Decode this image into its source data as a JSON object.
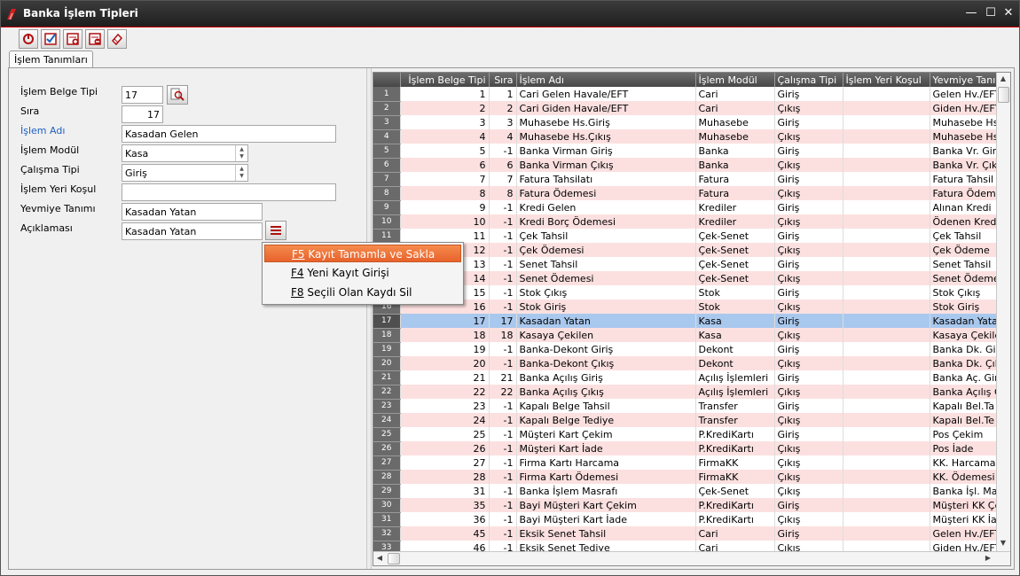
{
  "window": {
    "title": "Banka İşlem Tipleri",
    "minimize": "—",
    "maximize": "☐",
    "close": "✕"
  },
  "toolbar": {
    "buttons": [
      "power-icon",
      "check-list-icon",
      "add-record-icon",
      "delete-record-icon",
      "eraser-icon"
    ]
  },
  "tab": {
    "label": "İşlem Tanımları"
  },
  "form": {
    "islem_belge_tipi": {
      "label": "İşlem Belge Tipi",
      "value": "17"
    },
    "sira": {
      "label": "Sıra",
      "value": "17"
    },
    "islem_adi": {
      "label": "İşlem Adı",
      "value": "Kasadan Gelen"
    },
    "islem_modul": {
      "label": "İşlem Modül",
      "value": "Kasa"
    },
    "calisma_tipi": {
      "label": "Çalışma Tipi",
      "value": "Giriş"
    },
    "islem_yeri_kosul": {
      "label": "İşlem Yeri Koşul",
      "value": ""
    },
    "yevmiye_tanimi": {
      "label": "Yevmiye Tanımı",
      "value": "Kasadan Yatan"
    },
    "aciklamasi": {
      "label": "Açıklaması",
      "value": "Kasadan Yatan"
    }
  },
  "menu": {
    "items": [
      {
        "key": "F5",
        "label": "Kayıt Tamamla ve Sakla"
      },
      {
        "key": "F4",
        "label": "Yeni Kayıt Girişi"
      },
      {
        "key": "F8",
        "label": "Seçili Olan Kaydı Sil"
      }
    ]
  },
  "grid": {
    "columns": [
      "İşlem Belge Tipi",
      "Sıra",
      "İşlem Adı",
      "İşlem Modül",
      "Çalışma Tipi",
      "İşlem Yeri Koşul",
      "Yevmiye Tanım"
    ],
    "selected_row": 17,
    "rows": [
      [
        "1",
        "1",
        "1",
        "Cari Gelen Havale/EFT",
        "Cari",
        "Giriş",
        "",
        "Gelen Hv./EFT"
      ],
      [
        "2",
        "2",
        "2",
        "Cari Giden Havale/EFT",
        "Cari",
        "Çıkış",
        "",
        "Giden Hv./EFT"
      ],
      [
        "3",
        "3",
        "3",
        "Muhasebe Hs.Giriş",
        "Muhasebe",
        "Giriş",
        "",
        "Muhasebe Hs"
      ],
      [
        "4",
        "4",
        "4",
        "Muhasebe Hs.Çıkış",
        "Muhasebe",
        "Çıkış",
        "",
        "Muhasebe Hs"
      ],
      [
        "5",
        "5",
        "-1",
        "Banka Virman Giriş",
        "Banka",
        "Giriş",
        "",
        "Banka Vr. Giri"
      ],
      [
        "6",
        "6",
        "6",
        "Banka Virman Çıkış",
        "Banka",
        "Çıkış",
        "",
        "Banka Vr. Çıkı"
      ],
      [
        "7",
        "7",
        "7",
        "Fatura Tahsilatı",
        "Fatura",
        "Giriş",
        "",
        "Fatura Tahsil"
      ],
      [
        "8",
        "8",
        "8",
        "Fatura Ödemesi",
        "Fatura",
        "Çıkış",
        "",
        "Fatura Ödeme"
      ],
      [
        "9",
        "9",
        "-1",
        "Kredi Gelen",
        "Krediler",
        "Giriş",
        "",
        "Alınan Kredi"
      ],
      [
        "10",
        "10",
        "-1",
        "Kredi Borç Ödemesi",
        "Krediler",
        "Çıkış",
        "",
        "Ödenen Kredi"
      ],
      [
        "11",
        "11",
        "-1",
        "Çek Tahsil",
        "Çek-Senet",
        "Giriş",
        "",
        "Çek Tahsil"
      ],
      [
        "12",
        "12",
        "-1",
        "Çek Ödemesi",
        "Çek-Senet",
        "Çıkış",
        "",
        "Çek Ödeme"
      ],
      [
        "13",
        "13",
        "-1",
        "Senet Tahsil",
        "Çek-Senet",
        "Giriş",
        "",
        "Senet Tahsil"
      ],
      [
        "14",
        "14",
        "-1",
        "Senet Ödemesi",
        "Çek-Senet",
        "Çıkış",
        "",
        "Senet Ödeme"
      ],
      [
        "15",
        "15",
        "-1",
        "Stok Çıkış",
        "Stok",
        "Giriş",
        "",
        "Stok Çıkış"
      ],
      [
        "16",
        "16",
        "-1",
        "Stok Giriş",
        "Stok",
        "Çıkış",
        "",
        "Stok Giriş"
      ],
      [
        "17",
        "17",
        "17",
        "Kasadan Yatan",
        "Kasa",
        "Giriş",
        "",
        "Kasadan Yatan"
      ],
      [
        "18",
        "18",
        "18",
        "Kasaya Çekilen",
        "Kasa",
        "Çıkış",
        "",
        "Kasaya Çekile"
      ],
      [
        "19",
        "19",
        "-1",
        "Banka-Dekont Giriş",
        "Dekont",
        "Giriş",
        "",
        "Banka Dk. Gir"
      ],
      [
        "20",
        "20",
        "-1",
        "Banka-Dekont Çıkış",
        "Dekont",
        "Çıkış",
        "",
        "Banka Dk. Çık"
      ],
      [
        "21",
        "21",
        "21",
        "Banka Açılış Giriş",
        "Açılış İşlemleri",
        "Giriş",
        "",
        "Banka Aç. Gir"
      ],
      [
        "22",
        "22",
        "22",
        "Banka Açılış Çıkış",
        "Açılış İşlemleri",
        "Çıkış",
        "",
        "Banka Açılış Ç"
      ],
      [
        "23",
        "23",
        "-1",
        "Kapalı Belge Tahsil",
        "Transfer",
        "Giriş",
        "",
        "Kapalı Bel.Ta"
      ],
      [
        "24",
        "24",
        "-1",
        "Kapalı Belge Tediye",
        "Transfer",
        "Çıkış",
        "",
        "Kapalı Bel.Te"
      ],
      [
        "25",
        "25",
        "-1",
        "Müşteri Kart Çekim",
        "P.KrediKartı",
        "Giriş",
        "",
        "Pos Çekim"
      ],
      [
        "26",
        "26",
        "-1",
        "Müşteri Kart İade",
        "P.KrediKartı",
        "Çıkış",
        "",
        "Pos İade"
      ],
      [
        "27",
        "27",
        "-1",
        "Firma Kartı Harcama",
        "FirmaKK",
        "Çıkış",
        "",
        "KK. Harcamas"
      ],
      [
        "28",
        "28",
        "-1",
        "Firma Kartı Ödemesi",
        "FirmaKK",
        "Çıkış",
        "",
        "KK. Ödemesi"
      ],
      [
        "29",
        "31",
        "-1",
        "Banka İşlem Masrafı",
        "Çek-Senet",
        "Çıkış",
        "",
        "Banka İşl. Ma"
      ],
      [
        "30",
        "35",
        "-1",
        "Bayi Müşteri Kart Çekim",
        "P.KrediKartı",
        "Giriş",
        "",
        "Müşteri KK Çe"
      ],
      [
        "31",
        "36",
        "-1",
        "Bayi Müşteri Kart İade",
        "P.KrediKartı",
        "Çıkış",
        "",
        "Müşteri KK İa"
      ],
      [
        "32",
        "45",
        "-1",
        "Eksik Senet Tahsil",
        "Cari",
        "Giriş",
        "",
        "Gelen Hv./EFT"
      ],
      [
        "33",
        "46",
        "-1",
        "Eksik Senet Tediye",
        "Cari",
        "Çıkış",
        "",
        "Giden Hv./EFT"
      ]
    ]
  }
}
